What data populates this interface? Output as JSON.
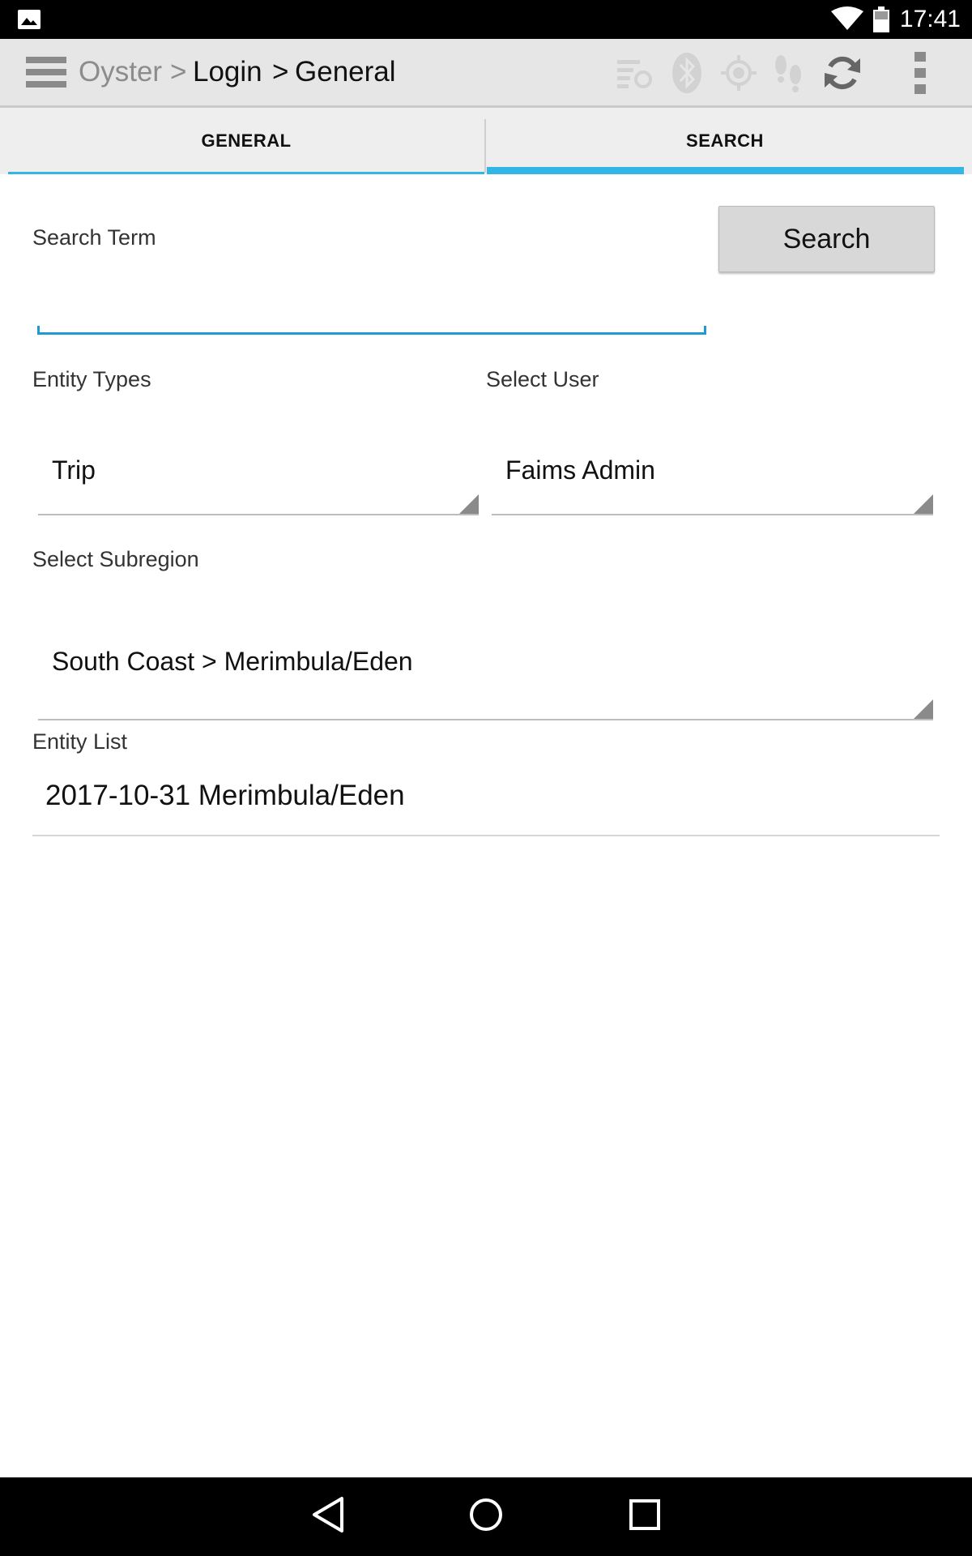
{
  "status_bar": {
    "time": "17:41",
    "icons": [
      "image-notification-icon",
      "wifi-icon",
      "battery-icon"
    ]
  },
  "action_bar": {
    "app_name": "Oyster",
    "separator1": ">",
    "crumb2": "Login",
    "separator2": ">",
    "crumb3": "General",
    "icons": [
      "menu-icon",
      "sync-status-icon",
      "bluetooth-icon",
      "gps-icon",
      "tracking-icon",
      "refresh-icon",
      "overflow-menu-icon"
    ]
  },
  "tabs": [
    {
      "label": "GENERAL",
      "selected": false
    },
    {
      "label": "SEARCH",
      "selected": true
    }
  ],
  "form": {
    "search_term_label": "Search Term",
    "search_term_value": "",
    "search_button_label": "Search",
    "entity_types_label": "Entity Types",
    "entity_types_value": "Trip",
    "select_user_label": "Select User",
    "select_user_value": "Faims Admin",
    "select_subregion_label": "Select Subregion",
    "select_subregion_value": "South Coast > Merimbula/Eden",
    "entity_list_label": "Entity List",
    "entity_list_items": [
      "2017-10-31 Merimbula/Eden"
    ]
  },
  "colors": {
    "accent": "#33b5e5",
    "input_underline": "#1e9bd1",
    "action_bar_bg": "#e6e6e6",
    "tab_bg": "#eeeeee"
  },
  "nav_bar": {
    "icons": [
      "back-icon",
      "home-icon",
      "recents-icon"
    ]
  }
}
